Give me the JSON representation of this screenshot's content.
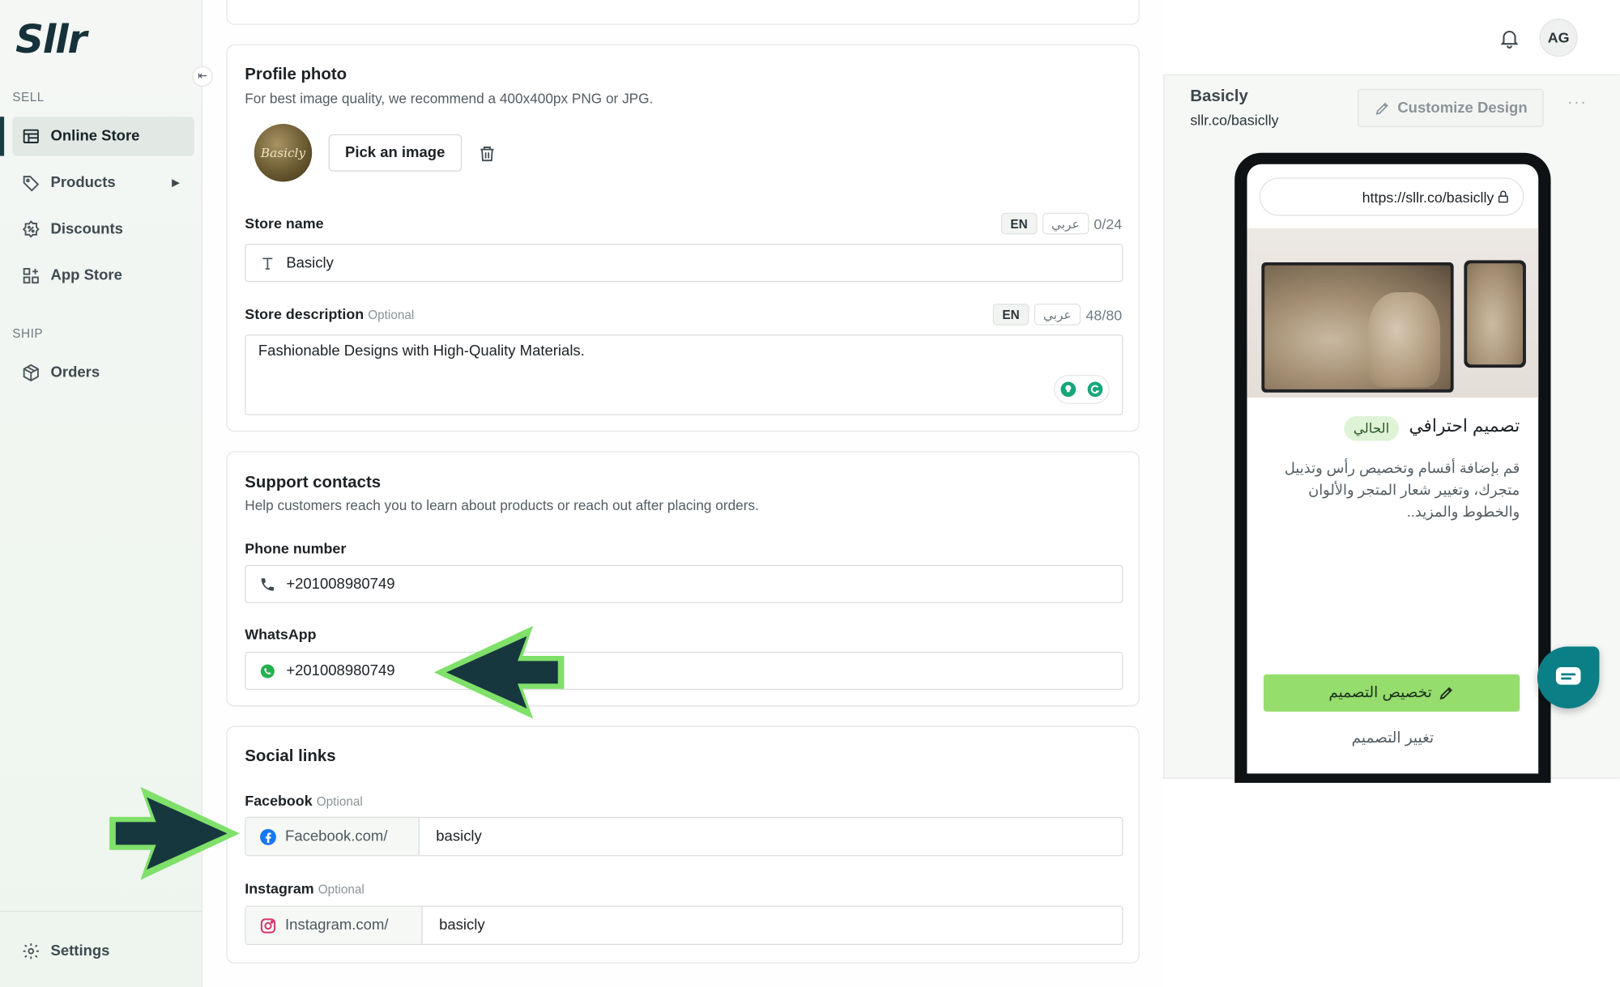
{
  "brand": {
    "logo_text": "Sllr"
  },
  "sidebar": {
    "sections": [
      {
        "label": "SELL"
      },
      {
        "label": "SHIP"
      }
    ],
    "items": [
      {
        "label": "Online Store",
        "icon": "store-icon",
        "active": true
      },
      {
        "label": "Products",
        "icon": "tag-icon",
        "has_submenu": true
      },
      {
        "label": "Discounts",
        "icon": "discount-icon"
      },
      {
        "label": "App Store",
        "icon": "apps-icon"
      },
      {
        "label": "Orders",
        "icon": "box-icon"
      }
    ],
    "settings_label": "Settings"
  },
  "profile_photo": {
    "title": "Profile photo",
    "subtitle": "For best image quality, we recommend a 400x400px PNG or JPG.",
    "logo_alt": "Basicly",
    "pick_label": "Pick an image"
  },
  "store_name": {
    "label": "Store name",
    "lang_en": "EN",
    "lang_ar": "عربي",
    "counter": "0/24",
    "value": "Basicly"
  },
  "store_description": {
    "label": "Store description",
    "optional": "Optional",
    "lang_en": "EN",
    "lang_ar": "عربي",
    "counter": "48/80",
    "value": "Fashionable Designs with High-Quality Materials."
  },
  "support": {
    "title": "Support contacts",
    "subtitle": "Help customers reach you to learn about products or reach out after placing orders.",
    "phone_label": "Phone number",
    "phone_value": "+201008980749",
    "whatsapp_label": "WhatsApp",
    "whatsapp_value": "+201008980749"
  },
  "social": {
    "title": "Social links",
    "facebook_label": "Facebook",
    "facebook_optional": "Optional",
    "facebook_prefix": "Facebook.com/",
    "facebook_value": "basicly",
    "instagram_label": "Instagram",
    "instagram_optional": "Optional",
    "instagram_prefix": "Instagram.com/",
    "instagram_value": "basicly"
  },
  "topbar": {
    "user_initials": "AG"
  },
  "preview": {
    "store_title": "Basicly",
    "store_url": "sllr.co/basiclly",
    "customize_label": "Customize Design",
    "more_label": "···",
    "phone_url": "https://sllr.co/basiclly",
    "design_title": "تصميم احترافي",
    "current_badge": "الحالي",
    "design_desc": "قم بإضافة أقسام وتخصيص رأس وتذييل متجرك، وتغيير شعار المتجر والألوان والخطوط والمزيد..",
    "customize_ar": "تخصيص التصميم",
    "change_ar": "تغيير التصميم"
  },
  "colors": {
    "accent_dark": "#1b3d44",
    "green_button": "#95dd6d",
    "chat": "#0b7f86",
    "annotation_arrow": "#17373f",
    "annotation_glow": "#7fe06a"
  }
}
